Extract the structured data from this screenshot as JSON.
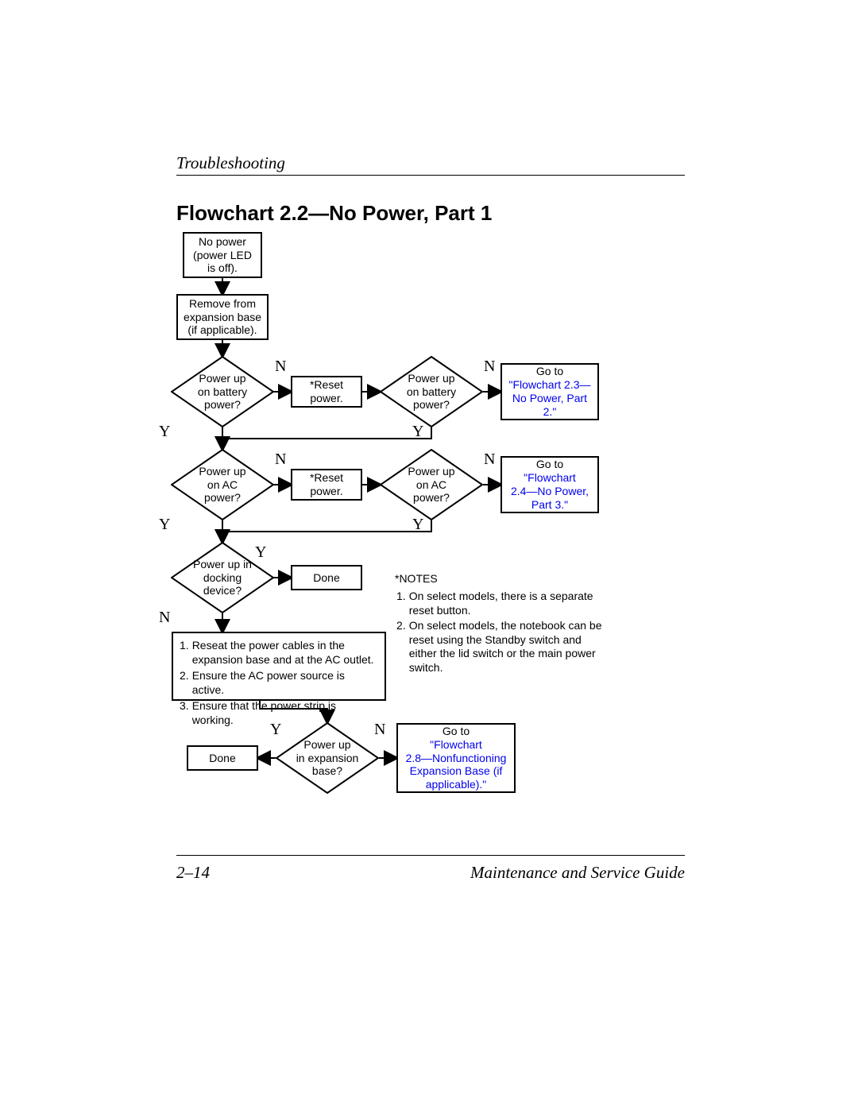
{
  "header": {
    "section": "Troubleshooting"
  },
  "title": "Flowchart 2.2—No Power, Part 1",
  "footer": {
    "page": "2–14",
    "guide": "Maintenance and Service Guide"
  },
  "nodes": {
    "start": "No power\n(power LED\nis off).",
    "remove": "Remove from\nexpansion base\n(if applicable).",
    "d_batt1": "Power up\non battery\npower?",
    "reset1": "*Reset\npower.",
    "d_batt2": "Power up\non battery\npower?",
    "goto23_pre": "Go to",
    "goto23_link": "\"Flowchart\n2.3—No Power,\nPart 2.\"",
    "d_ac1": "Power up\non AC\npower?",
    "reset2": "*Reset\npower.",
    "d_ac2": "Power up\non AC\npower?",
    "goto24_pre": "Go to",
    "goto24_link": "\"Flowchart\n2.4—No Power,\nPart 3.\"",
    "d_dock": "Power up in\ndocking\ndevice?",
    "done1": "Done",
    "troubleshoot": {
      "i1": "1.",
      "t1": "Reseat the power cables in the\nexpansion base and at the AC outlet.",
      "i2": "2.",
      "t2": "Ensure the AC power source is active.",
      "i3": "3.",
      "t3": "Ensure that the power strip is working."
    },
    "d_exp": "Power up\nin expansion\nbase?",
    "done2": "Done",
    "goto28_pre": "Go to",
    "goto28_link": "\"Flowchart\n2.8—Nonfunctioning\nExpansion Base (if\napplicable).\""
  },
  "notes": {
    "heading": "*NOTES",
    "i1": "1.",
    "t1": "On select models, there is a separate\nreset button.",
    "i2": "2.",
    "t2": "On select models, the notebook can be\nreset using the Standby switch and\neither the lid switch or the main power\nswitch."
  },
  "yn": {
    "y": "Y",
    "n": "N"
  }
}
